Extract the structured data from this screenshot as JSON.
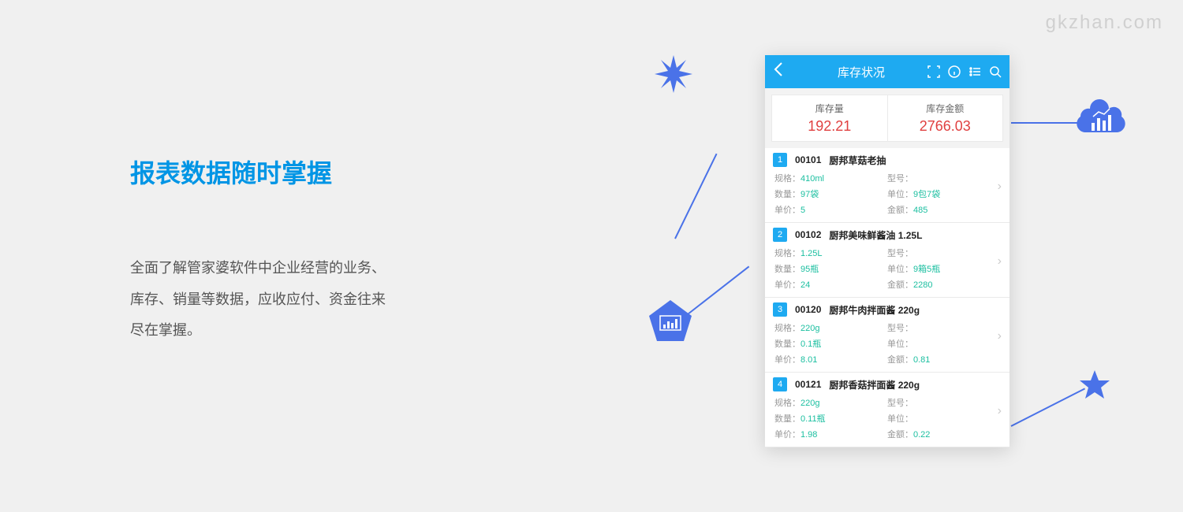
{
  "watermark": "gkzhan.com",
  "hero": {
    "title": "报表数据随时掌握",
    "desc_line1": "全面了解管家婆软件中企业经营的业务、",
    "desc_line2": "库存、销量等数据，应收应付、资金往来",
    "desc_line3": "尽在掌握。"
  },
  "phone": {
    "title": "库存状况",
    "summary": {
      "qty_label": "库存量",
      "qty_value": "192.21",
      "amt_label": "库存金额",
      "amt_value": "2766.03"
    },
    "labels": {
      "spec": "规格：",
      "model": "型号：",
      "qty": "数量：",
      "unit": "单位：",
      "price": "单价：",
      "amount": "金额："
    },
    "items": [
      {
        "index": "1",
        "code": "00101",
        "name": "厨邦草菇老抽",
        "spec": "410ml",
        "model": "",
        "qty": "97袋",
        "unit": "9包7袋",
        "price": "5",
        "amount": "485"
      },
      {
        "index": "2",
        "code": "00102",
        "name": "厨邦美味鲜酱油 1.25L",
        "spec": "1.25L",
        "model": "",
        "qty": "95瓶",
        "unit": "9箱5瓶",
        "price": "24",
        "amount": "2280"
      },
      {
        "index": "3",
        "code": "00120",
        "name": "厨邦牛肉拌面酱 220g",
        "spec": "220g",
        "model": "",
        "qty": "0.1瓶",
        "unit": "",
        "price": "8.01",
        "amount": "0.81"
      },
      {
        "index": "4",
        "code": "00121",
        "name": "厨邦香菇拌面酱 220g",
        "spec": "220g",
        "model": "",
        "qty": "0.11瓶",
        "unit": "",
        "price": "1.98",
        "amount": "0.22"
      }
    ]
  }
}
